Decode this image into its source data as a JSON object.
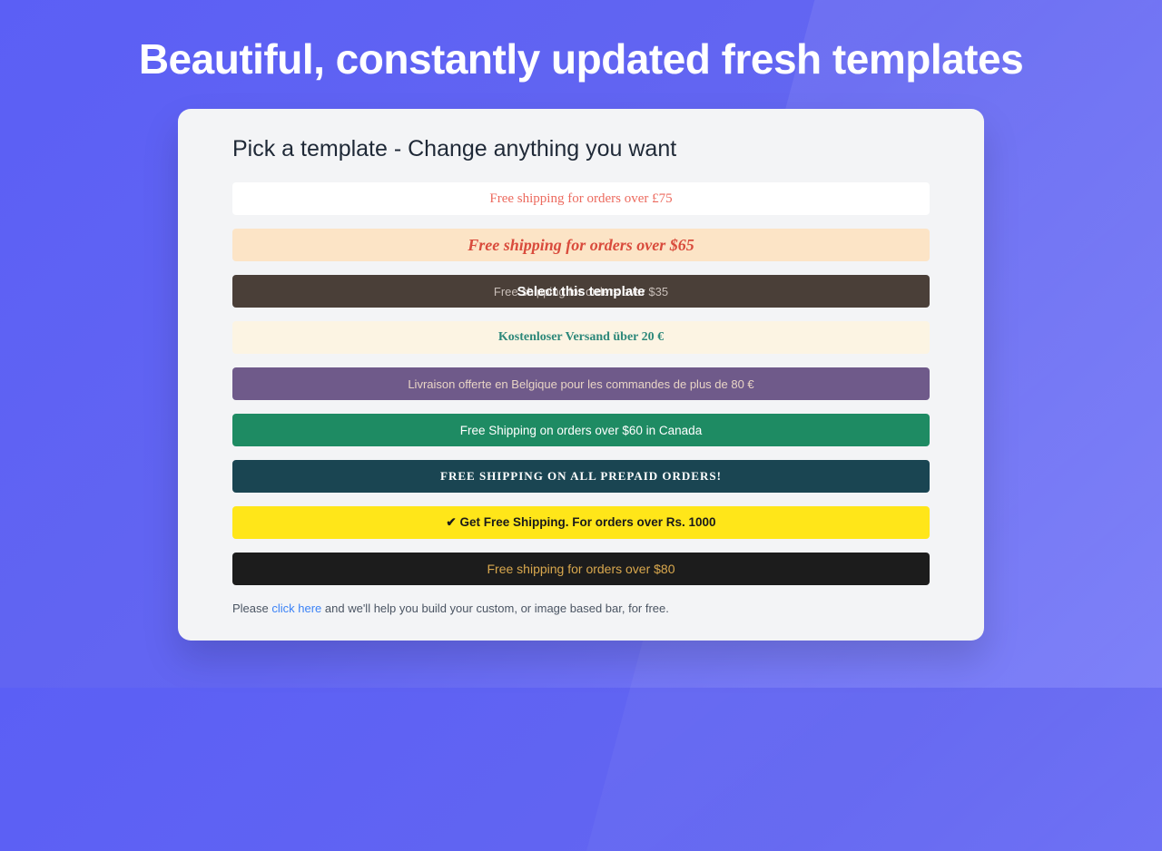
{
  "page_title": "Beautiful, constantly updated fresh templates",
  "card": {
    "heading": "Pick a template - Change anything you want",
    "bars": [
      {
        "text": "Free shipping for orders over £75"
      },
      {
        "text": "Free shipping for orders over $65"
      },
      {
        "under": "Free shipping for orders over $35",
        "overlay": "Select this template"
      },
      {
        "text": "Kostenloser Versand über 20 €"
      },
      {
        "text": "Livraison offerte en Belgique pour les commandes de plus de 80 €"
      },
      {
        "text": "Free Shipping on orders over $60 in Canada"
      },
      {
        "text": "FREE SHIPPING ON ALL PREPAID ORDERS!"
      },
      {
        "text": "✔ Get Free Shipping. For orders over Rs. 1000"
      },
      {
        "text": "Free shipping for orders over $80"
      }
    ],
    "footer": {
      "prefix": "Please ",
      "link": "click here",
      "suffix": " and we'll help you build your custom, or image based bar, for free."
    }
  }
}
